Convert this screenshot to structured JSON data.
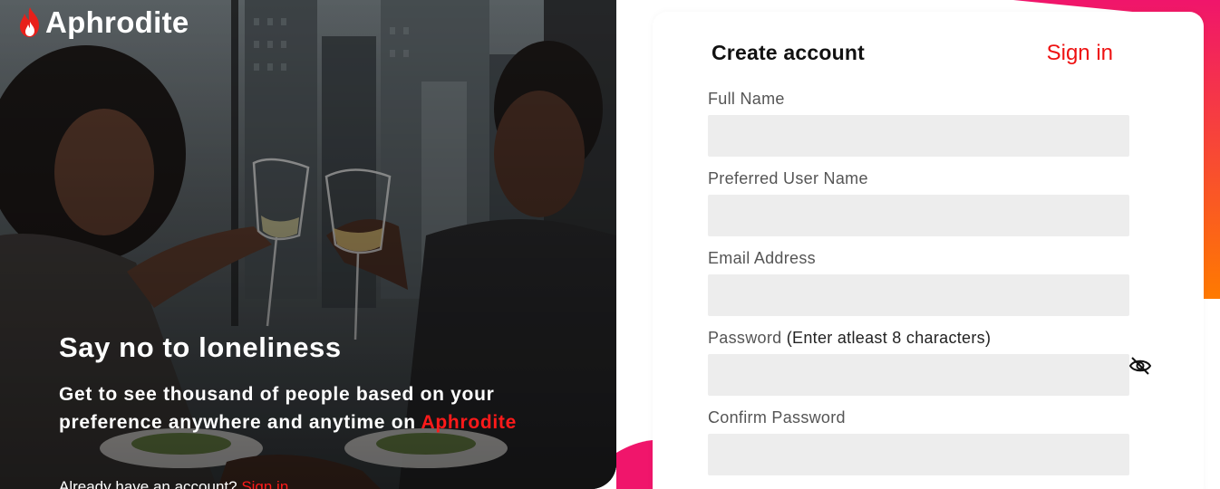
{
  "brand": {
    "name": "Aphrodite"
  },
  "hero": {
    "title": "Say no to loneliness",
    "subtitle_main": "Get to see thousand of people based on your preference anywhere and anytime on ",
    "subtitle_brand": "Aphrodite",
    "footer_text": "Already have an account? ",
    "footer_link": "Sign in"
  },
  "card": {
    "tab_create": "Create account",
    "tab_signin": "Sign in",
    "fields": {
      "full_name": {
        "label": "Full Name",
        "value": ""
      },
      "username": {
        "label": "Preferred User Name",
        "value": ""
      },
      "email": {
        "label": "Email Address",
        "value": ""
      },
      "password": {
        "label": "Password",
        "hint": "(Enter atleast 8 characters)",
        "value": ""
      },
      "confirm_password": {
        "label": "Confirm Password",
        "value": ""
      }
    }
  },
  "icons": {
    "brand": "flame-icon",
    "password_toggle": "eye-off-icon"
  },
  "colors": {
    "accent": "#ff1a1a",
    "gradient_top": "#f0156b",
    "gradient_bottom": "#ff7a00",
    "input_bg": "#ededed"
  }
}
